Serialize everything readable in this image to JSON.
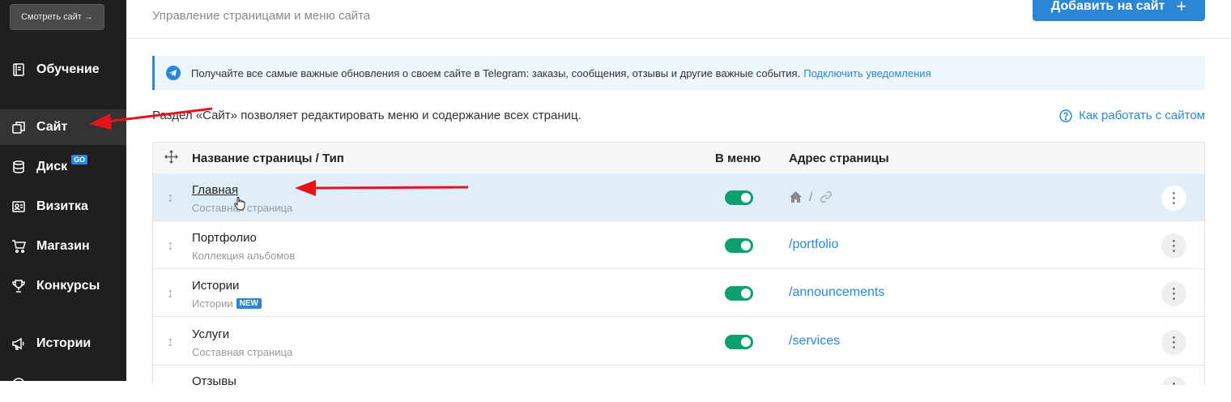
{
  "sidebar": {
    "view_site": "Смотреть сайт →",
    "items": [
      {
        "label": "Обучение",
        "icon": "book-icon"
      },
      {
        "label": "Сайт",
        "icon": "pages-icon",
        "active": true
      },
      {
        "label": "Диск",
        "icon": "database-icon",
        "badge": "GO"
      },
      {
        "label": "Визитка",
        "icon": "id-card-icon"
      },
      {
        "label": "Магазин",
        "icon": "cart-icon"
      },
      {
        "label": "Конкурсы",
        "icon": "trophy-icon"
      },
      {
        "label": "Истории",
        "icon": "megaphone-icon"
      }
    ]
  },
  "header": {
    "subtitle": "Управление страницами и меню сайта",
    "add_button": "Добавить на сайт"
  },
  "notice": {
    "text": "Получайте все самые важные обновления о своем сайте в Telegram: заказы, сообщения, отзывы и другие важные события.",
    "link": "Подключить уведомления"
  },
  "section": {
    "description": "Раздел «Сайт» позволяет редактировать меню и содержание всех страниц.",
    "help_link": "Как работать с сайтом"
  },
  "table": {
    "columns": {
      "name": "Название страницы / Тип",
      "in_menu": "В меню",
      "address": "Адрес страницы"
    },
    "rows": [
      {
        "name": "Главная",
        "type": "Составная страница",
        "in_menu": true,
        "address": "/"
      },
      {
        "name": "Портфолио",
        "type": "Коллекция альбомов",
        "in_menu": true,
        "address": "/portfolio"
      },
      {
        "name": "Истории",
        "type": "Истории",
        "badge": "NEW",
        "in_menu": true,
        "address": "/announcements"
      },
      {
        "name": "Услуги",
        "type": "Составная страница",
        "in_menu": true,
        "address": "/services"
      },
      {
        "name": "Отзывы",
        "type": "",
        "in_menu": true,
        "address": ""
      }
    ]
  },
  "colors": {
    "accent": "#2b86d6",
    "sidebar": "#1f1f1f",
    "toggle_on": "#0e9f6e",
    "annotation": "#e8131a"
  }
}
